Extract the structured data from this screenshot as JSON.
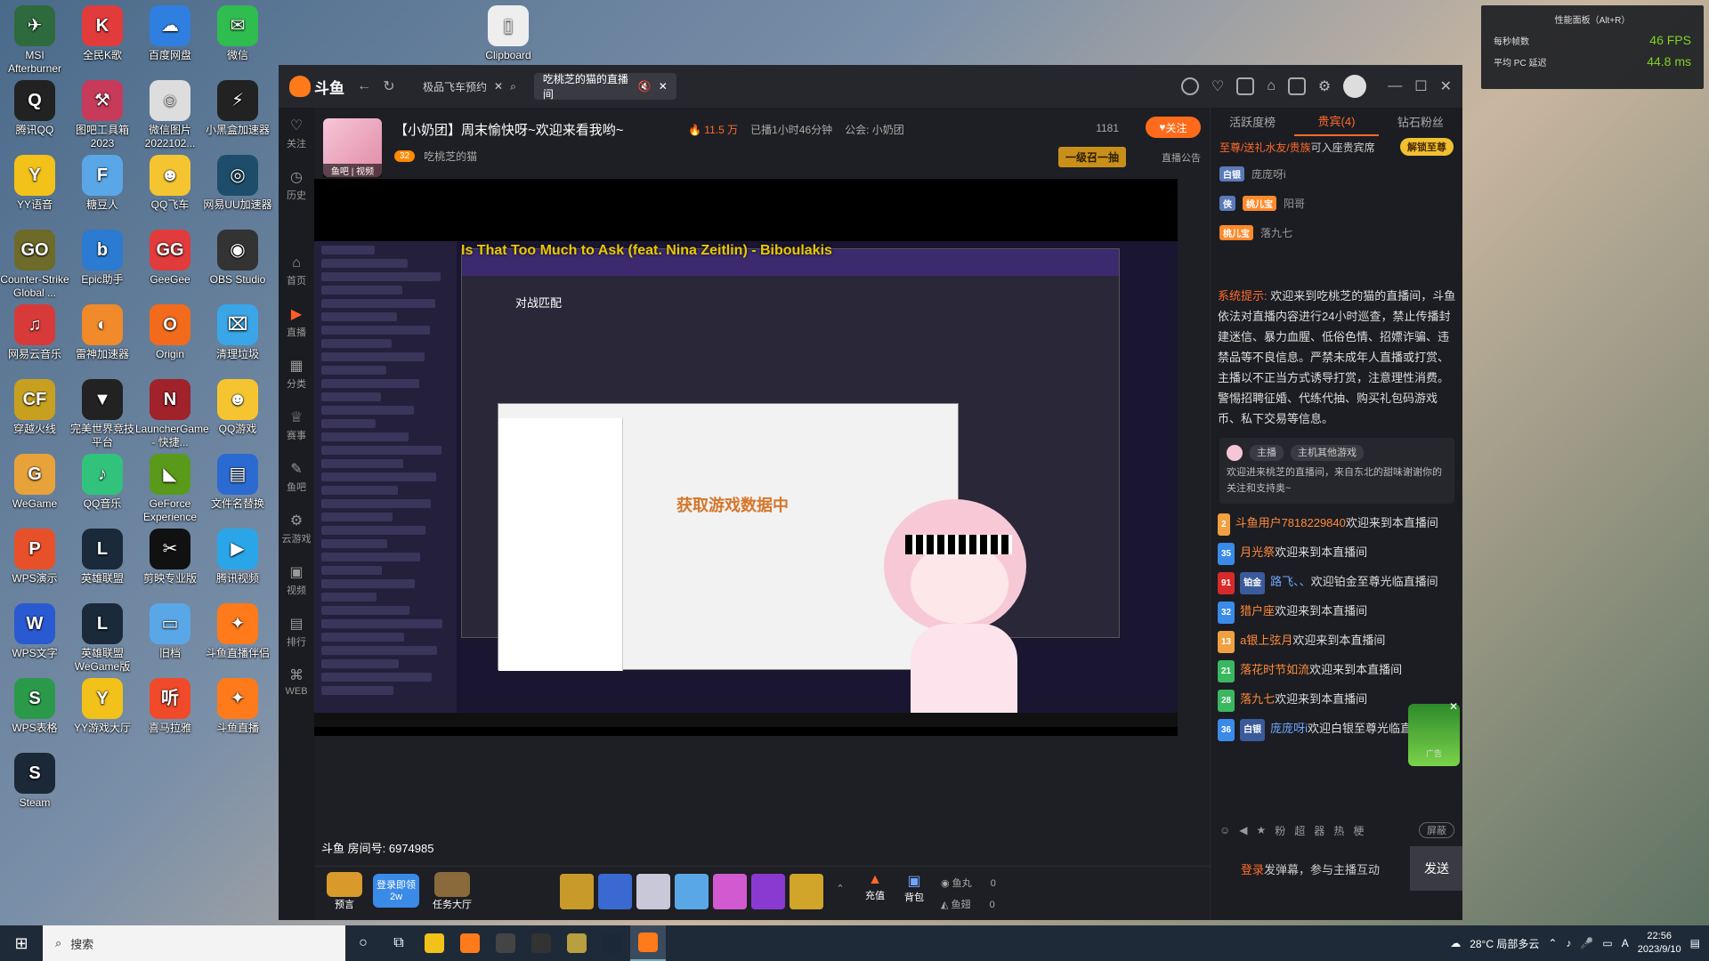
{
  "desktop": {
    "icons": [
      {
        "label": "MSI Afterburner",
        "color": "#2d6a3d",
        "glyph": "✈"
      },
      {
        "label": "全民K歌",
        "color": "#e23b3b",
        "glyph": "K"
      },
      {
        "label": "百度网盘",
        "color": "#2f7fe0",
        "glyph": "☁"
      },
      {
        "label": "微信",
        "color": "#2ebd4e",
        "glyph": "✉"
      },
      {
        "label": "腾讯QQ",
        "color": "#222",
        "glyph": "Q"
      },
      {
        "label": "图吧工具箱 2023",
        "color": "#c83a5a",
        "glyph": "⚒"
      },
      {
        "label": "微信图片 2022102...",
        "color": "#ddd",
        "glyph": "☺"
      },
      {
        "label": "小黑盒加速器",
        "color": "#222",
        "glyph": "⚡"
      },
      {
        "label": "YY语音",
        "color": "#f2c21a",
        "glyph": "Y"
      },
      {
        "label": "糖豆人",
        "color": "#5aa7e8",
        "glyph": "F"
      },
      {
        "label": "QQ飞车",
        "color": "#f5c531",
        "glyph": "☻"
      },
      {
        "label": "网易UU加速器",
        "color": "#1d4d6b",
        "glyph": "◎"
      },
      {
        "label": "Counter-Strike Global ...",
        "color": "#6d6a2a",
        "glyph": "GO"
      },
      {
        "label": "Epic助手",
        "color": "#2a7bd1",
        "glyph": "b"
      },
      {
        "label": "GeeGee",
        "color": "#e23b3b",
        "glyph": "GG"
      },
      {
        "label": "OBS Studio",
        "color": "#333",
        "glyph": "◉"
      },
      {
        "label": "网易云音乐",
        "color": "#d83a3a",
        "glyph": "♫"
      },
      {
        "label": "雷神加速器",
        "color": "#f08a2a",
        "glyph": "◐"
      },
      {
        "label": "Origin",
        "color": "#f26b1d",
        "glyph": "O"
      },
      {
        "label": "清理垃圾",
        "color": "#3aa6e8",
        "glyph": "⌧"
      },
      {
        "label": "穿越火线",
        "color": "#c8a020",
        "glyph": "CF"
      },
      {
        "label": "完美世界竞技平台",
        "color": "#222",
        "glyph": "▼"
      },
      {
        "label": "LauncherGame - 快捷...",
        "color": "#a0222a",
        "glyph": "N"
      },
      {
        "label": "QQ游戏",
        "color": "#f5c531",
        "glyph": "☻"
      },
      {
        "label": "WeGame",
        "color": "#e8a23a",
        "glyph": "G"
      },
      {
        "label": "QQ音乐",
        "color": "#31c27c",
        "glyph": "♪"
      },
      {
        "label": "GeForce Experience",
        "color": "#5a9a1a",
        "glyph": "◣"
      },
      {
        "label": "文件名替换",
        "color": "#2a6ad1",
        "glyph": "▤"
      },
      {
        "label": "WPS演示",
        "color": "#e8502a",
        "glyph": "P"
      },
      {
        "label": "英雄联盟",
        "color": "#1a2a3a",
        "glyph": "L"
      },
      {
        "label": "剪映专业版",
        "color": "#111",
        "glyph": "✂"
      },
      {
        "label": "腾讯视频",
        "color": "#2aa6e8",
        "glyph": "▶"
      },
      {
        "label": "WPS文字",
        "color": "#2a5ad1",
        "glyph": "W"
      },
      {
        "label": "英雄联盟 WeGame版",
        "color": "#1a2a3a",
        "glyph": "L"
      },
      {
        "label": "旧档",
        "color": "#5aa7e8",
        "glyph": "▭"
      },
      {
        "label": "斗鱼直播伴侣",
        "color": "#ff7a1a",
        "glyph": "✦"
      },
      {
        "label": "WPS表格",
        "color": "#2a9a4a",
        "glyph": "S"
      },
      {
        "label": "YY游戏大厅",
        "color": "#f2c21a",
        "glyph": "Y"
      },
      {
        "label": "喜马拉雅",
        "color": "#f04a2a",
        "glyph": "听"
      },
      {
        "label": "斗鱼直播",
        "color": "#ff7a1a",
        "glyph": "✦"
      },
      {
        "label": "Steam",
        "color": "#1b2838",
        "glyph": "S"
      },
      {
        "label": "Clipboard",
        "color": "#eee",
        "glyph": "▯"
      }
    ]
  },
  "perf_overlay": {
    "title": "性能面板（Alt+R）",
    "fps_label": "每秒帧数",
    "fps_value": "46 FPS",
    "latency_label": "平均 PC 延迟",
    "latency_value": "44.8 ms"
  },
  "window": {
    "tabs": [
      {
        "label": "极品飞车预约"
      },
      {
        "label": "吃桃芝的猫的直播间"
      }
    ],
    "sidebar": [
      {
        "label": "关注",
        "glyph": "♡"
      },
      {
        "label": "历史",
        "glyph": "◷"
      },
      {
        "label": "首页",
        "glyph": "⌂"
      },
      {
        "label": "直播",
        "glyph": "▶"
      },
      {
        "label": "分类",
        "glyph": "▦"
      },
      {
        "label": "赛事",
        "glyph": "♕"
      },
      {
        "label": "鱼吧",
        "glyph": "✎"
      },
      {
        "label": "云游戏",
        "glyph": "⚙"
      },
      {
        "label": "视频",
        "glyph": "▣"
      },
      {
        "label": "排行",
        "glyph": "▤"
      },
      {
        "label": "WEB",
        "glyph": "⌘"
      }
    ],
    "room": {
      "avatar_tag": "鱼吧 | 视频",
      "title": "【小奶团】周末愉快呀~欢迎来看我哟~",
      "hot": "11.5 万",
      "duration": "已播1小时46分钟",
      "guild": "公会: 小奶团",
      "level": "32",
      "streamer": "吃桃芝的猫",
      "follow_count": "1181",
      "follow_label": "关注",
      "call_badge": "一级召一抽",
      "notice": "直播公告"
    },
    "stream": {
      "song": "Is That Too Much to Ask (feat. Nina Zeitlin) - Biboulakis",
      "match_title": "对战匹配",
      "loading_text": "获取游戏数据中",
      "room_id_text": "斗鱼 房间号: 6974985"
    },
    "giftbar": {
      "predict": "预言",
      "login_reward": "登录即领2w",
      "task": "任务大厅",
      "recharge": "充值",
      "backpack": "背包",
      "fishball_label": "鱼丸",
      "fishball_value": "0",
      "fishfin_label": "鱼翅",
      "fishfin_value": "0",
      "gifts": [
        {
          "color": "#c89a2a"
        },
        {
          "color": "#3a6ad1"
        },
        {
          "color": "#c8c8d8"
        },
        {
          "color": "#5aa7e8"
        },
        {
          "color": "#d15ad1"
        },
        {
          "color": "#8a3ad1"
        },
        {
          "color": "#d1a42a"
        }
      ]
    },
    "right": {
      "tabs": [
        "活跃度榜",
        "贵宾(4)",
        "钻石粉丝"
      ],
      "vip_line_hl": "至尊/送礼水友/贵族",
      "vip_line_rest": "可入座贵宾席",
      "unlock": "解锁至尊",
      "vip_users": [
        {
          "badge": "白银",
          "badge_color": "#5a7ab8",
          "name": "庞庞呀i"
        },
        {
          "badge": "侠",
          "badge_color": "#5a7ab8",
          "fan": "桃儿宝",
          "name": "阳哥"
        },
        {
          "fan": "桃儿宝",
          "name": "落九七"
        }
      ],
      "sys_label": "系统提示:",
      "sys_text": "欢迎来到吃桃芝的猫的直播间，斗鱼依法对直播内容进行24小时巡查，禁止传播封建迷信、暴力血腥、低俗色情、招嫖诈骗、违禁品等不良信息。严禁未成年人直播或打赏、主播以不正当方式诱导打赏，注意理性消费。警惕招聘征婚、代练代抽、购买礼包码游戏币、私下交易等信息。",
      "welcome_pill1": "主播",
      "welcome_pill2": "主机其他游戏",
      "welcome_text": "欢迎进来桃芝的直播间，来自东北的甜味谢谢你的关注和支持奥~",
      "chat": [
        {
          "level": "2",
          "lv_color": "#f0a040",
          "name": "斗鱼用户7818229840",
          "msg": "欢迎来到本直播间",
          "blue": false
        },
        {
          "level": "35",
          "lv_color": "#3a8ae8",
          "name": "月光祭",
          "msg": "欢迎来到本直播间",
          "blue": false
        },
        {
          "level": "91",
          "lv_color": "#d82a2a",
          "badge": "铂金",
          "name": "路飞、、",
          "msg": "欢迎铂金至尊光临直播间",
          "blue": true
        },
        {
          "level": "32",
          "lv_color": "#3a8ae8",
          "name": "猎户座",
          "msg": "欢迎来到本直播间",
          "blue": false
        },
        {
          "level": "13",
          "lv_color": "#f0a040",
          "name": "a银上弦月",
          "msg": "欢迎来到本直播间",
          "blue": false
        },
        {
          "level": "21",
          "lv_color": "#3ab860",
          "name": "落花时节如流",
          "msg": "欢迎来到本直播间",
          "blue": false
        },
        {
          "level": "28",
          "lv_color": "#3ab860",
          "name": "落九七",
          "msg": "欢迎来到本直播间",
          "blue": false
        },
        {
          "level": "36",
          "lv_color": "#3a8ae8",
          "badge": "白银",
          "name": "庞庞呀i",
          "msg": "欢迎白银至尊光临直播间",
          "blue": true
        }
      ],
      "shield_label": "屏蔽",
      "input_icons": [
        "☺",
        "◀",
        "★",
        "粉",
        "超",
        "器",
        "热",
        "梗"
      ],
      "login_hl": "登录",
      "login_rest": "发弹幕，参与主播互动",
      "send": "发送",
      "ad_label": "广告"
    }
  },
  "taskbar": {
    "search_placeholder": "搜索",
    "weather": "28°C 局部多云",
    "time": "22:56",
    "date": "2023/9/10",
    "ime": "A",
    "apps": [
      "YY",
      "斗鱼伴侣",
      "OBS",
      "小黑盒",
      "完美",
      "Steam",
      "斗鱼"
    ]
  }
}
